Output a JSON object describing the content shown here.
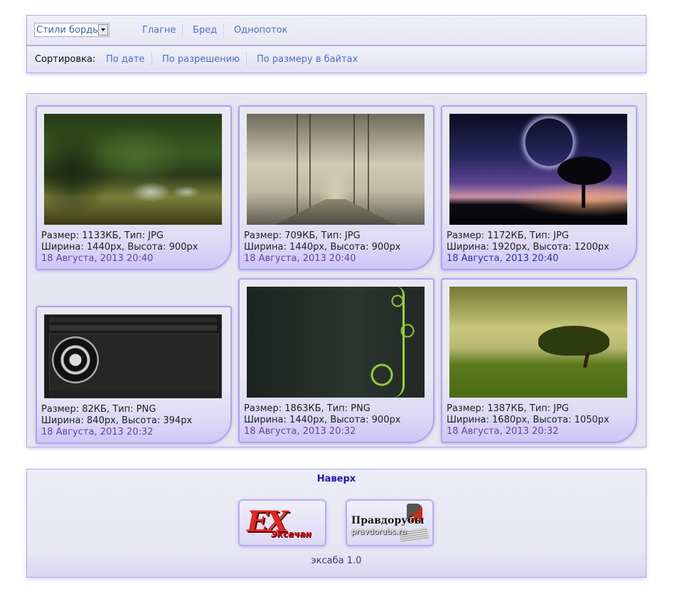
{
  "nav": {
    "styles_select": {
      "value": "Стили борды"
    },
    "links": [
      "Глагне",
      "Бред",
      "Однопоток"
    ],
    "sort_label": "Сортировка:",
    "sort_links": [
      "По дате",
      "По разрешению",
      "По размеру в байтах"
    ]
  },
  "gallery": {
    "images": [
      {
        "line1": "Размер: 1133КБ, Тип: JPG",
        "line2": "Ширина: 1440px, Высота: 900px",
        "date": "18 Августа, 2013 20:40",
        "thumb": "forest-waterfall-image"
      },
      {
        "line1": "Размер: 709КБ, Тип: JPG",
        "line2": "Ширина: 1440px, Высота: 900px",
        "date": "18 Августа, 2013 20:40",
        "thumb": "foggy-bridge-image"
      },
      {
        "line1": "Размер: 1172КБ, Тип: JPG",
        "line2": "Ширина: 1920px, Высота: 1200px",
        "date": "18 Августа, 2013 20:40",
        "thumb": "night-sky-tree-image"
      },
      {
        "line1": "Размер: 82КБ, Тип: PNG",
        "line2": "Ширина: 840px, Высота: 394px",
        "date": "18 Августа, 2013 20:32",
        "thumb": "exaba-screenshot-image"
      },
      {
        "line1": "Размер: 1863КБ, Тип: PNG",
        "line2": "Ширина: 1440px, Высота: 900px",
        "date": "18 Августа, 2013 20:32",
        "thumb": "green-vine-image"
      },
      {
        "line1": "Размер: 1387КБ, Тип: JPG",
        "line2": "Ширина: 1680px, Высота: 1050px",
        "date": "18 Августа, 2013 20:32",
        "thumb": "lone-tree-field-image"
      }
    ],
    "colors": {
      "date_purple": "#6b3fa4",
      "date_blue": "#2a34b8"
    }
  },
  "footer": {
    "top_link": "Наверх",
    "banner1": {
      "big": "EX",
      "small": "Эксачан"
    },
    "banner2": {
      "title": "Правдорубы",
      "sub": "pravdorubs.ru"
    },
    "version": "эксаба 1.0"
  }
}
